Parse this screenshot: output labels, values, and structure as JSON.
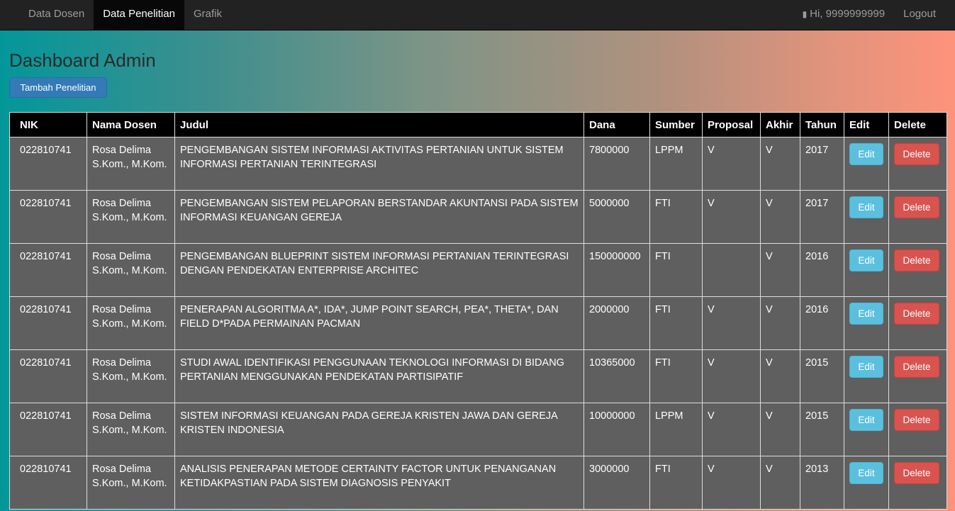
{
  "navbar": {
    "items": [
      {
        "label": "Data Dosen",
        "active": false
      },
      {
        "label": "Data Penelitian",
        "active": true
      },
      {
        "label": "Grafik",
        "active": false
      }
    ],
    "user_icon": "user-icon",
    "user_label": "Hi, 9999999999",
    "logout_label": "Logout"
  },
  "page": {
    "title": "Dashboard Admin",
    "add_button": "Tambah Penelitian"
  },
  "table": {
    "headers": [
      "NIK",
      "Nama Dosen",
      "Judul",
      "Dana",
      "Sumber",
      "Proposal",
      "Akhir",
      "Tahun",
      "Edit",
      "Delete"
    ],
    "edit_label": "Edit",
    "delete_label": "Delete",
    "rows": [
      {
        "nik": "022810741",
        "nama": "Rosa Delima S.Kom., M.Kom.",
        "judul": "PENGEMBANGAN SISTEM INFORMASI AKTIVITAS PERTANIAN UNTUK SISTEM INFORMASI PERTANIAN TERINTEGRASI",
        "dana": "7800000",
        "sumber": "LPPM",
        "proposal": "V",
        "akhir": "V",
        "tahun": "2017"
      },
      {
        "nik": "022810741",
        "nama": "Rosa Delima S.Kom., M.Kom.",
        "judul": "PENGEMBANGAN SISTEM PELAPORAN BERSTANDAR AKUNTANSI PADA SISTEM INFORMASI KEUANGAN GEREJA",
        "dana": "5000000",
        "sumber": "FTI",
        "proposal": "V",
        "akhir": "V",
        "tahun": "2017"
      },
      {
        "nik": "022810741",
        "nama": "Rosa Delima S.Kom., M.Kom.",
        "judul": "PENGEMBANGAN BLUEPRINT SISTEM INFORMASI PERTANIAN TERINTEGRASI DENGAN PENDEKATAN ENTERPRISE ARCHITEC",
        "dana": "150000000",
        "sumber": "FTI",
        "proposal": "",
        "akhir": "V",
        "tahun": "2016"
      },
      {
        "nik": "022810741",
        "nama": "Rosa Delima S.Kom., M.Kom.",
        "judul": "PENERAPAN ALGORITMA A*, IDA*, JUMP POINT SEARCH, PEA*, THETA*, DAN FIELD D*PADA PERMAINAN PACMAN",
        "dana": "2000000",
        "sumber": "FTI",
        "proposal": "V",
        "akhir": "V",
        "tahun": "2016"
      },
      {
        "nik": "022810741",
        "nama": "Rosa Delima S.Kom., M.Kom.",
        "judul": "STUDI AWAL IDENTIFIKASI PENGGUNAAN TEKNOLOGI INFORMASI DI BIDANG PERTANIAN MENGGUNAKAN PENDEKATAN PARTISIPATIF",
        "dana": "10365000",
        "sumber": "FTI",
        "proposal": "V",
        "akhir": "V",
        "tahun": "2015"
      },
      {
        "nik": "022810741",
        "nama": "Rosa Delima S.Kom., M.Kom.",
        "judul": "SISTEM INFORMASI KEUANGAN PADA GEREJA KRISTEN JAWA DAN GEREJA KRISTEN INDONESIA",
        "dana": "10000000",
        "sumber": "LPPM",
        "proposal": "V",
        "akhir": "V",
        "tahun": "2015"
      },
      {
        "nik": "022810741",
        "nama": "Rosa Delima S.Kom., M.Kom.",
        "judul": "ANALISIS PENERAPAN METODE CERTAINTY FACTOR UNTUK PENANGANAN KETIDAKPASTIAN PADA SISTEM DIAGNOSIS PENYAKIT",
        "dana": "3000000",
        "sumber": "FTI",
        "proposal": "V",
        "akhir": "V",
        "tahun": "2013"
      }
    ]
  }
}
